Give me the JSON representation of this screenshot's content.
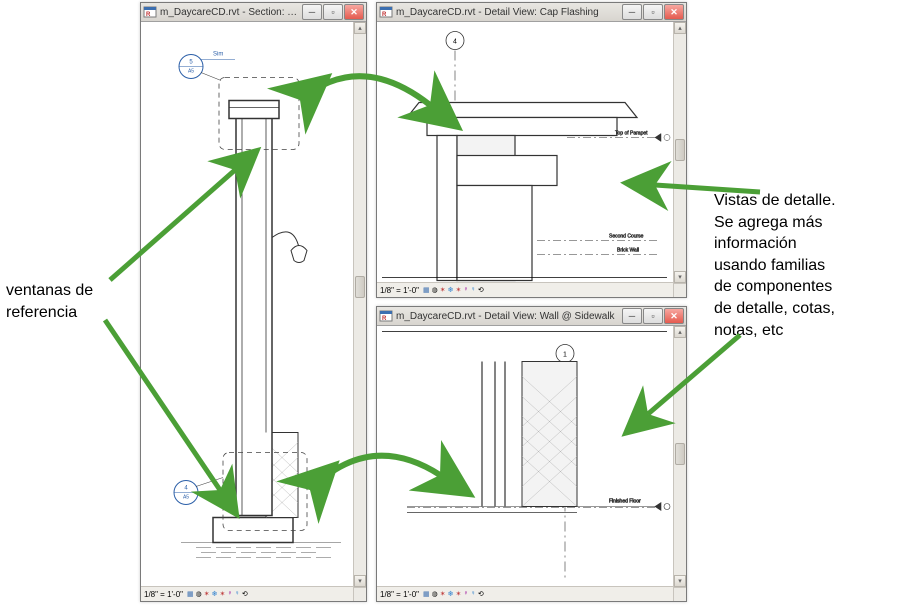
{
  "annotations": {
    "left": "ventanas de\nreferencia",
    "right": "Vistas de detalle.\nSe agrega más\ninformación\nusando familias\nde componentes\nde detalle, cotas,\nnotas, etc"
  },
  "windows": {
    "section": {
      "title": "m_DaycareCD.rvt - Section: Ty...",
      "scale": "1/8\" = 1'-0\"",
      "callouts": {
        "top_num": "5",
        "top_sheet": "A5",
        "bottom_num": "4",
        "bottom_sheet": "A5"
      },
      "sim_label": "Sim"
    },
    "detail_cap": {
      "title": "m_DaycareCD.rvt - Detail View: Cap Flashing",
      "scale": "1/8\" = 1'-0\"",
      "callout_num": "4",
      "labels": {
        "top": "Top of Parapet",
        "bottom1": "Second Course",
        "bottom2": "Brick Wall"
      }
    },
    "detail_wall": {
      "title": "m_DaycareCD.rvt - Detail View: Wall @ Sidewalk",
      "scale": "1/8\" = 1'-0\"",
      "callout_num": "1",
      "label": "Finished Floor"
    }
  },
  "arrow_color": "#4b9f36"
}
